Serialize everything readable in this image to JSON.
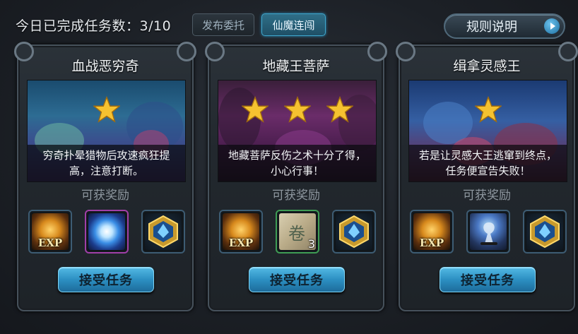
{
  "header": {
    "task_count_label": "今日已完成任务数：3/10",
    "tabs": [
      {
        "label": "发布委托",
        "active": false
      },
      {
        "label": "仙魔连闯",
        "active": true
      }
    ],
    "rules_button": "规则说明"
  },
  "reward_label": "可获奖励",
  "accept_label": "接受任务",
  "cards": [
    {
      "title": "血战恶穷奇",
      "stars": 1,
      "description": "穷奇扑晕猎物后攻速疯狂提高，注意打断。",
      "rewards": [
        "exp-icon",
        "orb-icon",
        "hexagon-gem-icon"
      ]
    },
    {
      "title": "地藏王菩萨",
      "stars": 3,
      "description": "地藏菩萨反伤之术十分了得，小心行事！",
      "rewards": [
        "exp-icon",
        "scroll-icon",
        "hexagon-gem-icon"
      ],
      "scroll_qty": "3"
    },
    {
      "title": "缉拿灵感王",
      "stars": 1,
      "description": "若是让灵感大王逃窜到终点，任务便宣告失败！",
      "rewards": [
        "exp-icon",
        "lamp-icon",
        "hexagon-gem-icon"
      ]
    }
  ],
  "exp_text": "EXP",
  "colors": {
    "accent_blue": "#2c8fc2",
    "star_gold": "#f5c230",
    "panel_border": "#46515b"
  }
}
